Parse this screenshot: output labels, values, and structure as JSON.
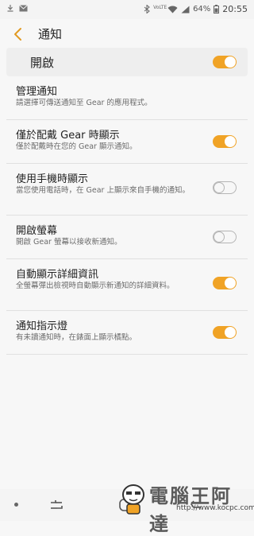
{
  "status_bar": {
    "battery": "64%",
    "time": "20:55",
    "left_icons": [
      "download-icon",
      "mail-icon"
    ],
    "right_icons": [
      "bluetooth-icon",
      "volte-icon",
      "wifi-icon",
      "signal-icon",
      "battery-icon"
    ]
  },
  "header": {
    "title": "通知"
  },
  "master_switch": {
    "label": "開啟",
    "on": true
  },
  "items": [
    {
      "title": "管理通知",
      "desc": "請選擇可傳送通知至 Gear 的應用程式。"
    },
    {
      "title": "僅於配戴 Gear 時顯示",
      "desc": "僅於配戴時在您的 Gear 顯示通知。",
      "on": true
    },
    {
      "title": "使用手機時顯示",
      "desc": "當您使用電話時，在 Gear 上顯示來自手機的通知。",
      "on": false
    },
    {
      "title": "開啟螢幕",
      "desc": "開啟 Gear 螢幕以接收新通知。",
      "on": false
    },
    {
      "title": "自動顯示詳細資訊",
      "desc": "全螢幕彈出檢視時自動顯示新通知的詳細資料。",
      "on": true
    },
    {
      "title": "通知指示燈",
      "desc": "有未讀通知時，在錶面上顯示橘點。",
      "on": true
    }
  ],
  "watermark": {
    "text": "電腦王阿達",
    "url": "http://www.kocpc.com.tw"
  },
  "colors": {
    "accent": "#f0a326",
    "background": "#f7f7f7"
  }
}
